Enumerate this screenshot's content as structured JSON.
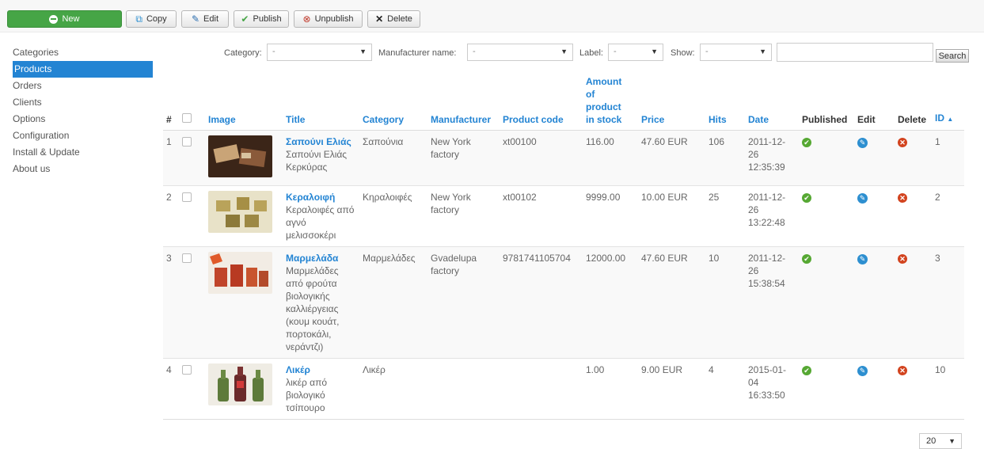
{
  "toolbar": {
    "new": "New",
    "copy": "Copy",
    "edit": "Edit",
    "publish": "Publish",
    "unpublish": "Unpublish",
    "delete": "Delete"
  },
  "sidebar": {
    "items": [
      "Categories",
      "Products",
      "Orders",
      "Clients",
      "Options",
      "Configuration",
      "Install & Update",
      "About us"
    ],
    "active": "Products"
  },
  "filters": {
    "category_label": "Category:",
    "category_value": "-",
    "manufacturer_label": "Manufacturer name:",
    "manufacturer_value": "-",
    "label_label": "Label:",
    "label_value": "-",
    "show_label": "Show:",
    "show_value": "-",
    "search_value": "",
    "search_button": "Search"
  },
  "table": {
    "headers": {
      "num": "#",
      "image": "Image",
      "title": "Title",
      "category": "Category",
      "manufacturer": "Manufacturer",
      "code": "Product code",
      "stock_1": "Amount",
      "stock_2": "of",
      "stock_3": "product",
      "stock_4": "in stock",
      "price": "Price",
      "hits": "Hits",
      "date": "Date",
      "published": "Published",
      "edit": "Edit",
      "delete": "Delete",
      "id": "ID",
      "id_sort": "▲"
    },
    "rows": [
      {
        "num": "1",
        "title": "Σαπούνι Ελιάς",
        "desc": "Σαπούνι Ελιάς Κερκύρας",
        "category": "Σαπούνια",
        "manufacturer": "New York factory",
        "code": "xt00100",
        "stock": "116.00",
        "price": "47.60 EUR",
        "hits": "106",
        "date": "2011-12-26 12:35:39",
        "id": "1"
      },
      {
        "num": "2",
        "title": "Κεραλοιφή",
        "desc": "Κεραλοιφές από αγνό μελισσοκέρι",
        "category": "Κηραλοιφές",
        "manufacturer": "New York factory",
        "code": "xt00102",
        "stock": "9999.00",
        "price": "10.00 EUR",
        "hits": "25",
        "date": "2011-12-26 13:22:48",
        "id": "2"
      },
      {
        "num": "3",
        "title": "Μαρμελάδα",
        "desc": "Μαρμελάδες από φρούτα βιολογικής καλλιέργειας (κουμ κουάτ, πορτοκάλι, νεράντζι)",
        "category": "Μαρμελάδες",
        "manufacturer": "Gvadelupa factory",
        "code": "9781741105704",
        "stock": "12000.00",
        "price": "47.60 EUR",
        "hits": "10",
        "date": "2011-12-26 15:38:54",
        "id": "3"
      },
      {
        "num": "4",
        "title": "Λικέρ",
        "desc": "λικέρ από βιολογικό τσίπουρο",
        "category": "Λικέρ",
        "manufacturer": "",
        "code": "",
        "stock": "1.00",
        "price": "9.00 EUR",
        "hits": "4",
        "date": "2015-01-04 16:33:50",
        "id": "10"
      }
    ]
  },
  "pagination": {
    "per_page": "20"
  }
}
